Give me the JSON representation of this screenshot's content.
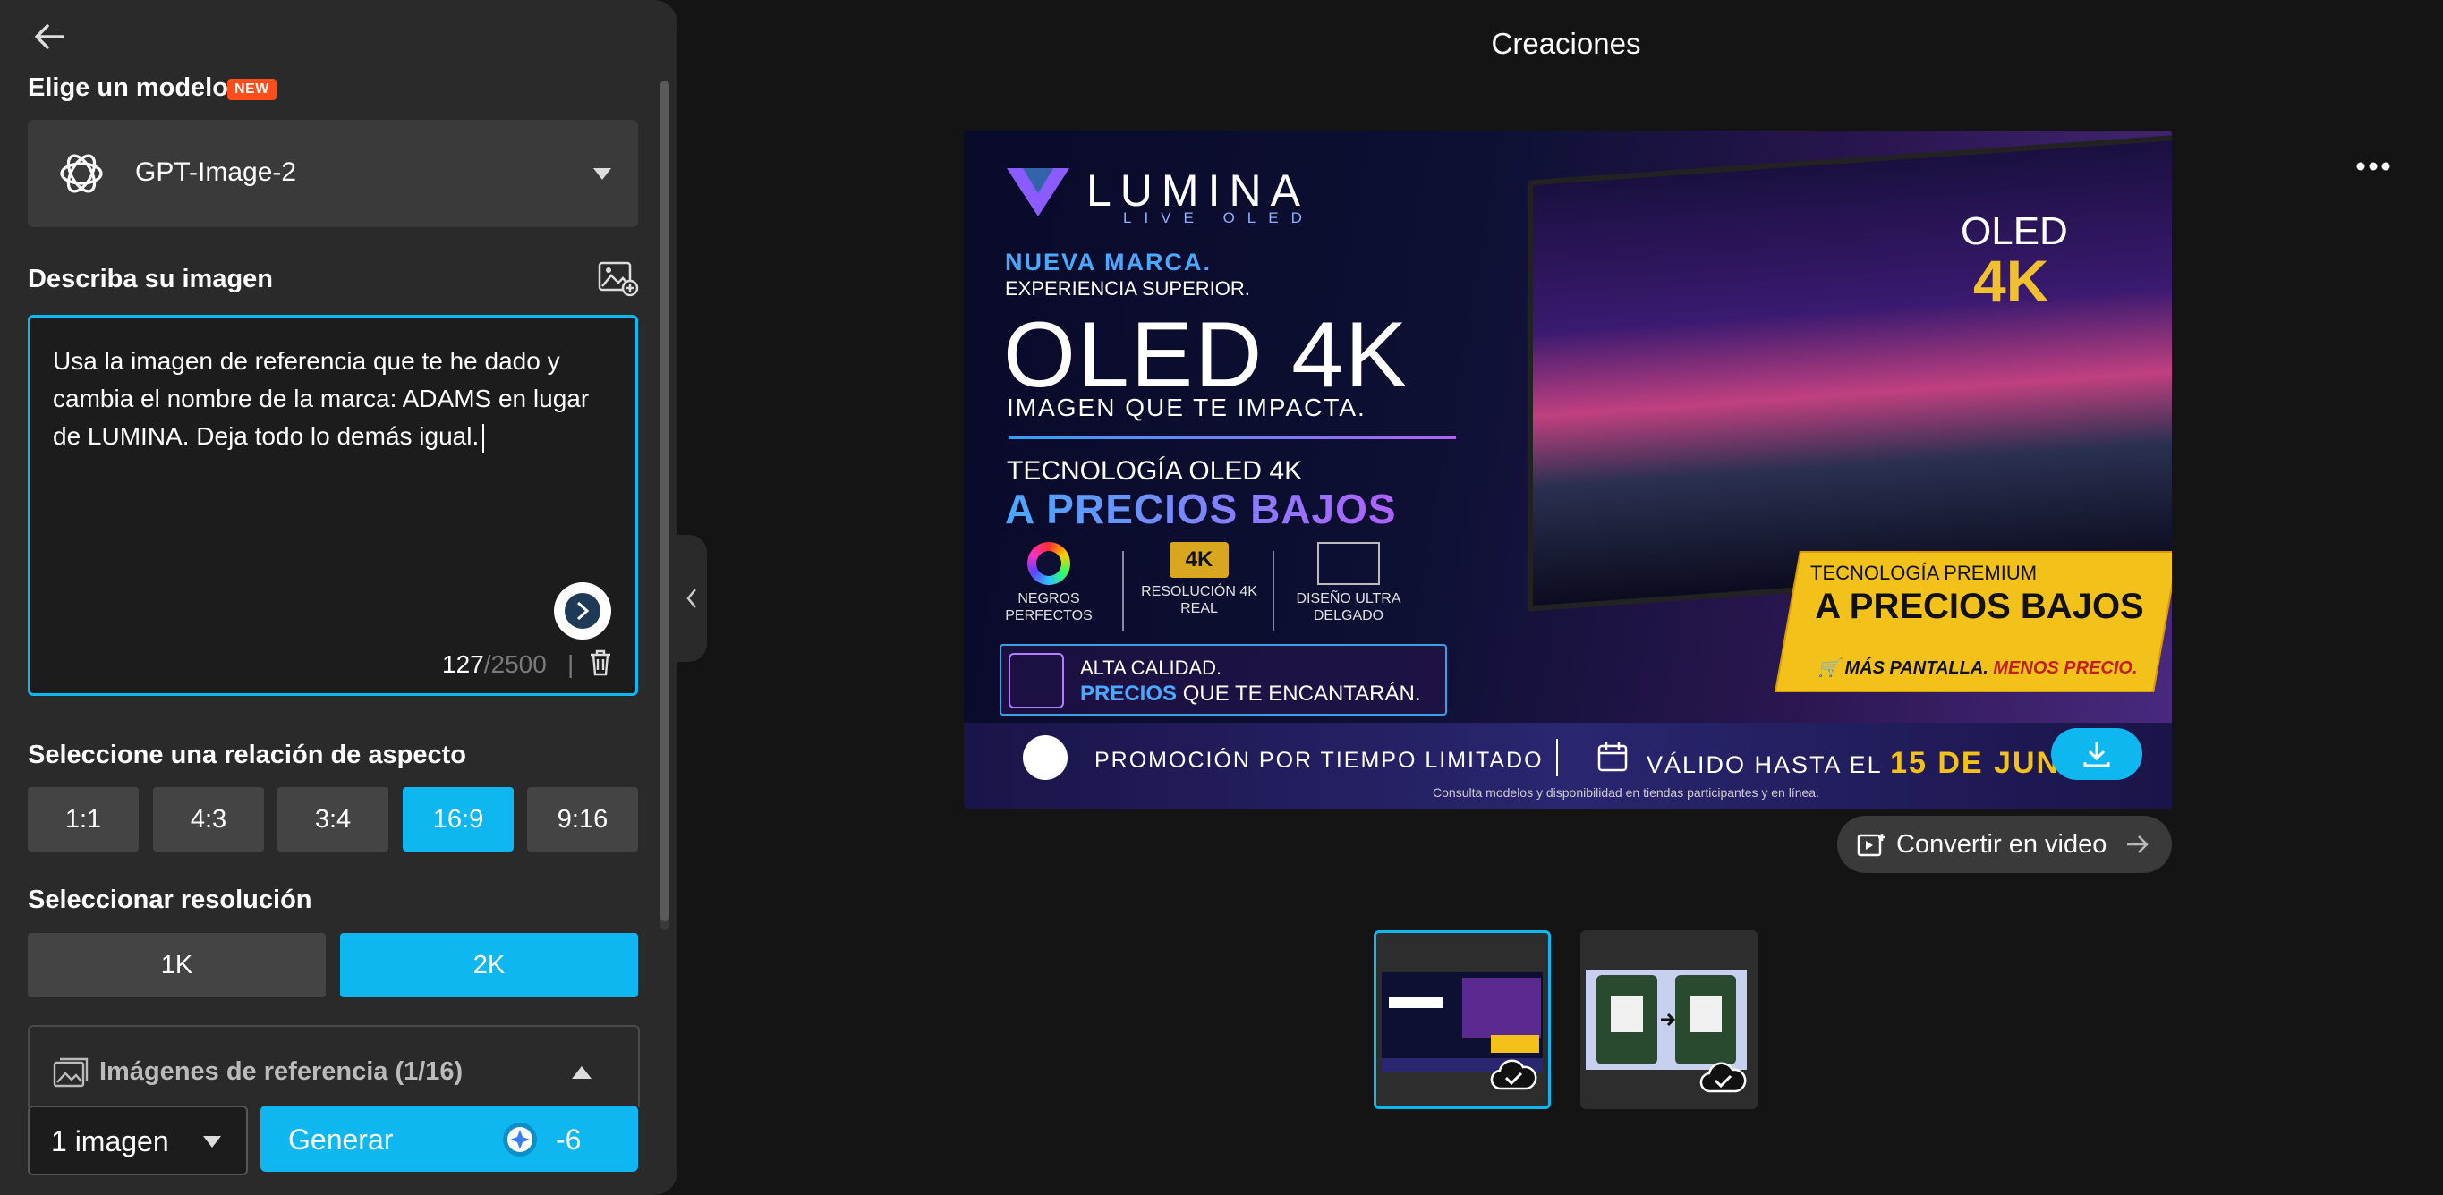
{
  "sidebar": {
    "model_section_label": "Elige un modelo",
    "new_badge": "NEW",
    "model_name": "GPT-Image-2",
    "prompt_section_label": "Describa su imagen",
    "prompt_text": "Usa la imagen de referencia que te he dado y cambia el nombre de la marca: ADAMS en lugar de LUMINA. Deja todo lo demás igual.",
    "char_count": "127",
    "char_max": "/2500",
    "char_sep": "|",
    "aspect_section_label": "Seleccione una relación de aspecto",
    "aspect_ratios": [
      "1:1",
      "4:3",
      "3:4",
      "16:9",
      "9:16"
    ],
    "aspect_selected": "16:9",
    "resolution_section_label": "Seleccionar resolución",
    "resolutions": [
      "1K",
      "2K"
    ],
    "resolution_selected": "2K",
    "reference_label": "Imágenes de referencia (1/16)",
    "image_count": "1 imagen",
    "generate_label": "Generar",
    "credit_cost": "-6"
  },
  "main": {
    "title": "Creaciones",
    "convert_label": "Convertir en video"
  },
  "poster": {
    "brand": "LUMINA",
    "brand_sub": "LIVE OLED",
    "kicker": "NUEVA MARCA.",
    "kicker2": "EXPERIENCIA SUPERIOR.",
    "headline": "OLED 4K",
    "sub": "IMAGEN QUE TE IMPACTA.",
    "tech": "TECNOLOGÍA OLED 4K",
    "price": "A PRECIOS BAJOS",
    "feature1": "NEGROS PERFECTOS",
    "feature2": "RESOLUCIÓN 4K REAL",
    "feature3": "DISEÑO ULTRA DELGADO",
    "badge_4k": "4K",
    "quality1": "ALTA CALIDAD.",
    "quality2_bold": "PRECIOS",
    "quality2_rest": " QUE TE ENCANTARÁN.",
    "tv_oled": "OLED",
    "tv_4k": "4K",
    "promo1": "TECNOLOGÍA PREMIUM",
    "promo2": "A PRECIOS BAJOS",
    "promo3_a": "MÁS PANTALLA.",
    "promo3_b": " MENOS PRECIO.",
    "footer1": "PROMOCIÓN POR TIEMPO LIMITADO",
    "footer2_a": "VÁLIDO HASTA EL ",
    "footer2_b": "15 DE JUN",
    "footer3": "Consulta modelos y disponibilidad en tiendas participantes y en línea."
  },
  "colors": {
    "accent": "#0fb7f0",
    "sidebar_bg": "#2a2a2a",
    "page_bg": "#141414",
    "badge": "#ff4d1c"
  }
}
